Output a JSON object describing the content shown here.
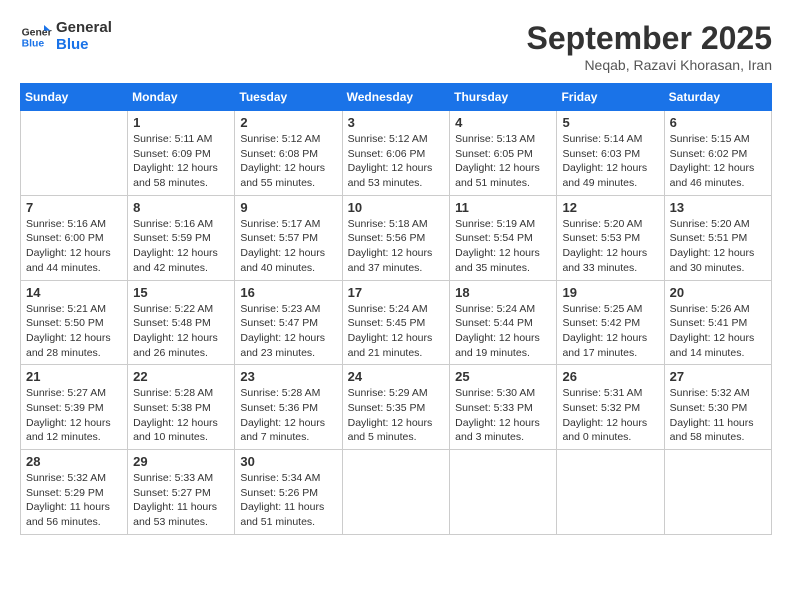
{
  "logo": {
    "line1": "General",
    "line2": "Blue"
  },
  "title": "September 2025",
  "subtitle": "Neqab, Razavi Khorasan, Iran",
  "weekdays": [
    "Sunday",
    "Monday",
    "Tuesday",
    "Wednesday",
    "Thursday",
    "Friday",
    "Saturday"
  ],
  "weeks": [
    [
      {
        "day": "",
        "info": ""
      },
      {
        "day": "1",
        "info": "Sunrise: 5:11 AM\nSunset: 6:09 PM\nDaylight: 12 hours\nand 58 minutes."
      },
      {
        "day": "2",
        "info": "Sunrise: 5:12 AM\nSunset: 6:08 PM\nDaylight: 12 hours\nand 55 minutes."
      },
      {
        "day": "3",
        "info": "Sunrise: 5:12 AM\nSunset: 6:06 PM\nDaylight: 12 hours\nand 53 minutes."
      },
      {
        "day": "4",
        "info": "Sunrise: 5:13 AM\nSunset: 6:05 PM\nDaylight: 12 hours\nand 51 minutes."
      },
      {
        "day": "5",
        "info": "Sunrise: 5:14 AM\nSunset: 6:03 PM\nDaylight: 12 hours\nand 49 minutes."
      },
      {
        "day": "6",
        "info": "Sunrise: 5:15 AM\nSunset: 6:02 PM\nDaylight: 12 hours\nand 46 minutes."
      }
    ],
    [
      {
        "day": "7",
        "info": "Sunrise: 5:16 AM\nSunset: 6:00 PM\nDaylight: 12 hours\nand 44 minutes."
      },
      {
        "day": "8",
        "info": "Sunrise: 5:16 AM\nSunset: 5:59 PM\nDaylight: 12 hours\nand 42 minutes."
      },
      {
        "day": "9",
        "info": "Sunrise: 5:17 AM\nSunset: 5:57 PM\nDaylight: 12 hours\nand 40 minutes."
      },
      {
        "day": "10",
        "info": "Sunrise: 5:18 AM\nSunset: 5:56 PM\nDaylight: 12 hours\nand 37 minutes."
      },
      {
        "day": "11",
        "info": "Sunrise: 5:19 AM\nSunset: 5:54 PM\nDaylight: 12 hours\nand 35 minutes."
      },
      {
        "day": "12",
        "info": "Sunrise: 5:20 AM\nSunset: 5:53 PM\nDaylight: 12 hours\nand 33 minutes."
      },
      {
        "day": "13",
        "info": "Sunrise: 5:20 AM\nSunset: 5:51 PM\nDaylight: 12 hours\nand 30 minutes."
      }
    ],
    [
      {
        "day": "14",
        "info": "Sunrise: 5:21 AM\nSunset: 5:50 PM\nDaylight: 12 hours\nand 28 minutes."
      },
      {
        "day": "15",
        "info": "Sunrise: 5:22 AM\nSunset: 5:48 PM\nDaylight: 12 hours\nand 26 minutes."
      },
      {
        "day": "16",
        "info": "Sunrise: 5:23 AM\nSunset: 5:47 PM\nDaylight: 12 hours\nand 23 minutes."
      },
      {
        "day": "17",
        "info": "Sunrise: 5:24 AM\nSunset: 5:45 PM\nDaylight: 12 hours\nand 21 minutes."
      },
      {
        "day": "18",
        "info": "Sunrise: 5:24 AM\nSunset: 5:44 PM\nDaylight: 12 hours\nand 19 minutes."
      },
      {
        "day": "19",
        "info": "Sunrise: 5:25 AM\nSunset: 5:42 PM\nDaylight: 12 hours\nand 17 minutes."
      },
      {
        "day": "20",
        "info": "Sunrise: 5:26 AM\nSunset: 5:41 PM\nDaylight: 12 hours\nand 14 minutes."
      }
    ],
    [
      {
        "day": "21",
        "info": "Sunrise: 5:27 AM\nSunset: 5:39 PM\nDaylight: 12 hours\nand 12 minutes."
      },
      {
        "day": "22",
        "info": "Sunrise: 5:28 AM\nSunset: 5:38 PM\nDaylight: 12 hours\nand 10 minutes."
      },
      {
        "day": "23",
        "info": "Sunrise: 5:28 AM\nSunset: 5:36 PM\nDaylight: 12 hours\nand 7 minutes."
      },
      {
        "day": "24",
        "info": "Sunrise: 5:29 AM\nSunset: 5:35 PM\nDaylight: 12 hours\nand 5 minutes."
      },
      {
        "day": "25",
        "info": "Sunrise: 5:30 AM\nSunset: 5:33 PM\nDaylight: 12 hours\nand 3 minutes."
      },
      {
        "day": "26",
        "info": "Sunrise: 5:31 AM\nSunset: 5:32 PM\nDaylight: 12 hours\nand 0 minutes."
      },
      {
        "day": "27",
        "info": "Sunrise: 5:32 AM\nSunset: 5:30 PM\nDaylight: 11 hours\nand 58 minutes."
      }
    ],
    [
      {
        "day": "28",
        "info": "Sunrise: 5:32 AM\nSunset: 5:29 PM\nDaylight: 11 hours\nand 56 minutes."
      },
      {
        "day": "29",
        "info": "Sunrise: 5:33 AM\nSunset: 5:27 PM\nDaylight: 11 hours\nand 53 minutes."
      },
      {
        "day": "30",
        "info": "Sunrise: 5:34 AM\nSunset: 5:26 PM\nDaylight: 11 hours\nand 51 minutes."
      },
      {
        "day": "",
        "info": ""
      },
      {
        "day": "",
        "info": ""
      },
      {
        "day": "",
        "info": ""
      },
      {
        "day": "",
        "info": ""
      }
    ]
  ]
}
